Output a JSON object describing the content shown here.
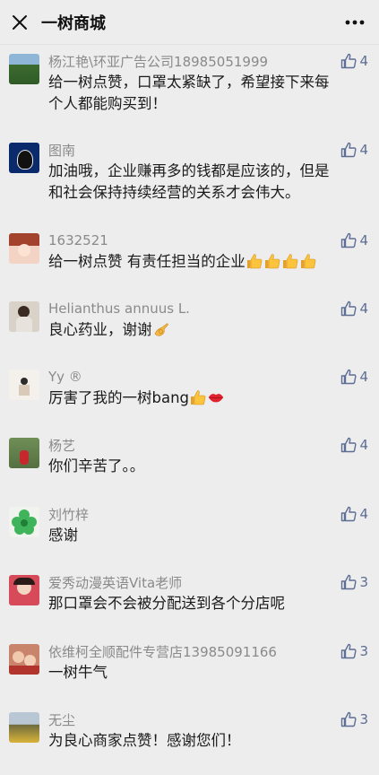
{
  "header": {
    "title": "一树商城",
    "close_icon": "close-icon",
    "more_icon": "more-icon"
  },
  "colors": {
    "background": "#ededed",
    "like_blue": "#5d6d94",
    "name_gray": "#8a8a8a",
    "text": "#1a1a1a"
  },
  "comments": [
    {
      "name": "杨江艳\\环亚广告公司18985051999",
      "likes": "4",
      "lines": [
        "给一树点赞，口罩太紧缺了，希望接下来每",
        "个人都能购买到！"
      ],
      "emojis": []
    },
    {
      "name": "图南",
      "likes": "4",
      "lines": [
        "加油哦，企业赚再多的钱都是应该的，但是",
        "和社会保持持续经营的关系才会伟大。"
      ],
      "emojis": []
    },
    {
      "name": "1632521",
      "likes": "4",
      "lines": [
        "给一树点赞  有责任担当的企业"
      ],
      "emojis": [
        "thumbs-up",
        "thumbs-up",
        "thumbs-up",
        "thumbs-up"
      ]
    },
    {
      "name": "Helianthus annuus L.",
      "likes": "4",
      "lines": [
        "良心药业，谢谢"
      ],
      "emojis": [
        "ok-hand"
      ]
    },
    {
      "name": "Yy ®",
      "likes": "4",
      "lines": [
        "厉害了我的一树bang"
      ],
      "emojis": [
        "thumbs-up",
        "lips"
      ]
    },
    {
      "name": "杨艺",
      "likes": "4",
      "lines": [
        "你们辛苦了。。"
      ],
      "emojis": []
    },
    {
      "name": "刘竹梓",
      "likes": "4",
      "lines": [
        "感谢"
      ],
      "emojis": []
    },
    {
      "name": "爱秀动漫英语Vita老师",
      "likes": "3",
      "lines": [
        "那口罩会不会被分配送到各个分店呢"
      ],
      "emojis": []
    },
    {
      "name": "依维柯全顺配件专营店13985091166",
      "likes": "3",
      "lines": [
        "一树牛气"
      ],
      "emojis": []
    },
    {
      "name": "无尘",
      "likes": "3",
      "lines": [
        "为良心商家点赞！感谢您们！"
      ],
      "emojis": []
    }
  ]
}
